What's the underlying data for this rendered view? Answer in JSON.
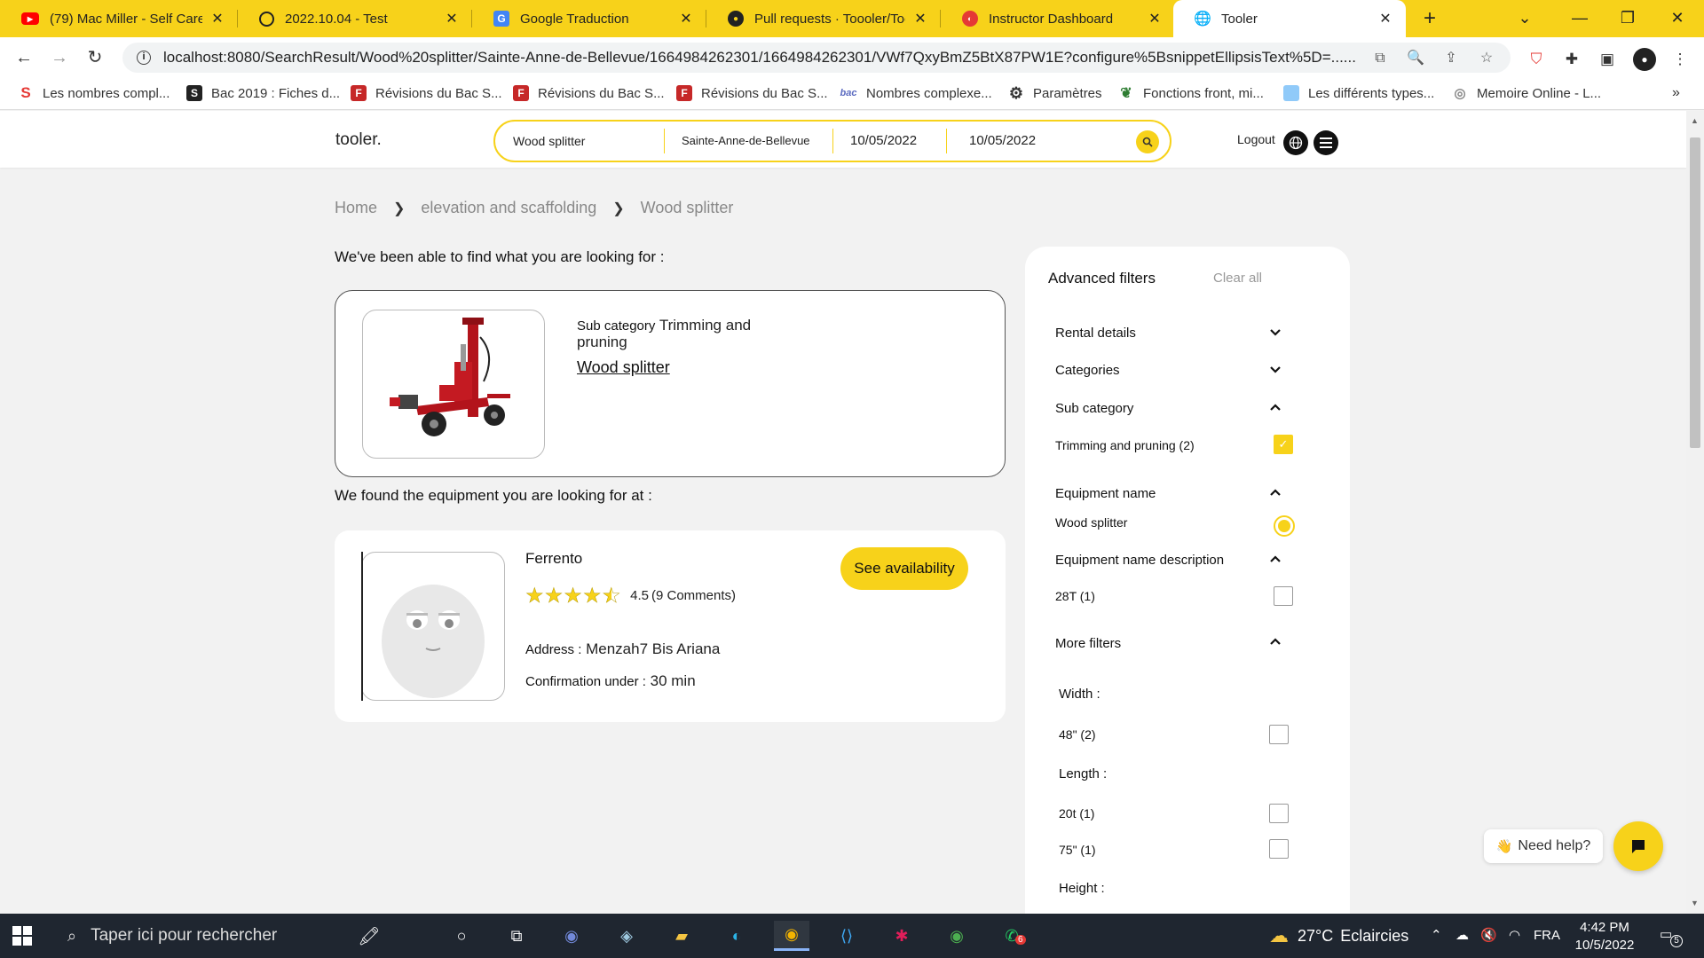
{
  "browser": {
    "tabs": [
      {
        "label": "(79) Mac Miller - Self Care -",
        "icon": "youtube-icon",
        "color": "#ff0000"
      },
      {
        "label": "2022.10.04 - Test",
        "icon": "quiz-icon",
        "color": "#222222"
      },
      {
        "label": "Google Traduction",
        "icon": "google-translate-icon",
        "color": "#4285f4"
      },
      {
        "label": "Pull requests · Toooler/Tooler",
        "icon": "github-icon",
        "color": "#222222"
      },
      {
        "label": "Instructor Dashboard",
        "icon": "instructor-icon",
        "color": "#e53935"
      },
      {
        "label": "Tooler",
        "icon": "globe-icon",
        "color": "#333333"
      }
    ],
    "url": "localhost:8080/SearchResult/Wood%20splitter/Sainte-Anne-de-Bellevue/1664984262301/1664984262301/VWf7QxyBmZ5BtX87PW1E?configure%5BsnippetEllipsisText%5D=......",
    "url_host": "localhost",
    "bookmarks": [
      {
        "label": "Les nombres compl...",
        "icon": "s-logo-icon",
        "color": "#e53935"
      },
      {
        "label": "Bac 2019 : Fiches d...",
        "icon": "s-box-icon",
        "color": "#222222"
      },
      {
        "label": "Révisions du Bac S...",
        "icon": "f-logo-icon",
        "color": "#c62828"
      },
      {
        "label": "Révisions du Bac S...",
        "icon": "f-logo-icon",
        "color": "#c62828"
      },
      {
        "label": "Révisions du Bac S...",
        "icon": "f-logo-icon",
        "color": "#c62828"
      },
      {
        "label": "Nombres complexe...",
        "icon": "bac-logo-icon",
        "color": "#5c6bc0"
      },
      {
        "label": "Paramètres",
        "icon": "gear-icon",
        "color": "#333333"
      },
      {
        "label": "Fonctions front, mi...",
        "icon": "leaf-icon",
        "color": "#2e7d32"
      },
      {
        "label": "Les différents types...",
        "icon": "folder-icon",
        "color": "#64b5f6"
      },
      {
        "label": "Memoire Online - L...",
        "icon": "globe-icon",
        "color": "#888888"
      }
    ],
    "more_bookmarks": "»"
  },
  "header": {
    "logo": "tooler.",
    "search": {
      "equipment": "Wood splitter",
      "location": "Sainte-Anne-de-Bellevue",
      "start_date": "10/05/2022",
      "end_date": "10/05/2022"
    },
    "logout": "Logout"
  },
  "breadcrumb": {
    "home": "Home",
    "category": "elevation and scaffolding",
    "current": "Wood splitter"
  },
  "results": {
    "intro": "We've been able to find what you are looking for :",
    "subcategory_key": "Sub category",
    "subcategory_value": "Trimming and pruning",
    "equipment_link": "Wood splitter",
    "found_heading": "We found the equipment you are looking for at :"
  },
  "store": {
    "name": "Ferrento",
    "rating": 4.5,
    "rating_text": "4.5",
    "comments_text": "(9 Comments)",
    "address_key": "Address :",
    "address_value": "Menzah7 Bis Ariana",
    "confirmation_key": "Confirmation under :",
    "confirmation_value": "30 min",
    "availability_button": "See availability"
  },
  "filters": {
    "title": "Advanced filters",
    "clear_all": "Clear all",
    "rental_details": "Rental details",
    "categories": "Categories",
    "sub_category": "Sub category",
    "sub_category_option": "Trimming and pruning (2)",
    "sub_category_checked": true,
    "equipment_name": "Equipment name",
    "equipment_name_option": "Wood splitter",
    "equipment_name_selected": true,
    "equipment_name_description": "Equipment name description",
    "description_option": "28T (1)",
    "more_filters": "More filters",
    "width_label": "Width :",
    "width_option": "48\" (2)",
    "length_label": "Length :",
    "length_option_1": "20t (1)",
    "length_option_2": "75\" (1)",
    "height_label": "Height :"
  },
  "help": {
    "need_help": "Need help?",
    "wave": "👋"
  },
  "taskbar": {
    "search_placeholder": "Taper ici pour rechercher",
    "temperature": "27°C",
    "weather": "Eclaircies",
    "language": "FRA",
    "time": "4:42 PM",
    "date": "10/5/2022",
    "notification_count": "5",
    "whatsapp_badge": "6"
  },
  "colors": {
    "accent": "#f7d21a",
    "taskbar": "#1f2630"
  }
}
